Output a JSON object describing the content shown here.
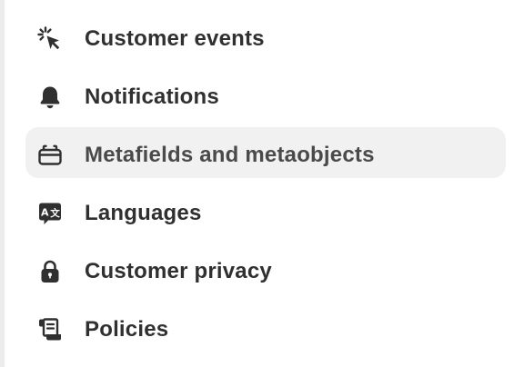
{
  "sidebar": {
    "items": [
      {
        "label": "Customer events",
        "icon": "cursor-sparkle-icon",
        "active": false
      },
      {
        "label": "Notifications",
        "icon": "bell-icon",
        "active": false
      },
      {
        "label": "Metafields and metaobjects",
        "icon": "metafield-box-icon",
        "active": true
      },
      {
        "label": "Languages",
        "icon": "translate-icon",
        "active": false
      },
      {
        "label": "Customer privacy",
        "icon": "lock-icon",
        "active": false
      },
      {
        "label": "Policies",
        "icon": "scroll-icon",
        "active": false
      }
    ]
  },
  "colors": {
    "text": "#303030",
    "active_background": "#f1f1f1",
    "icon": "#303030"
  }
}
